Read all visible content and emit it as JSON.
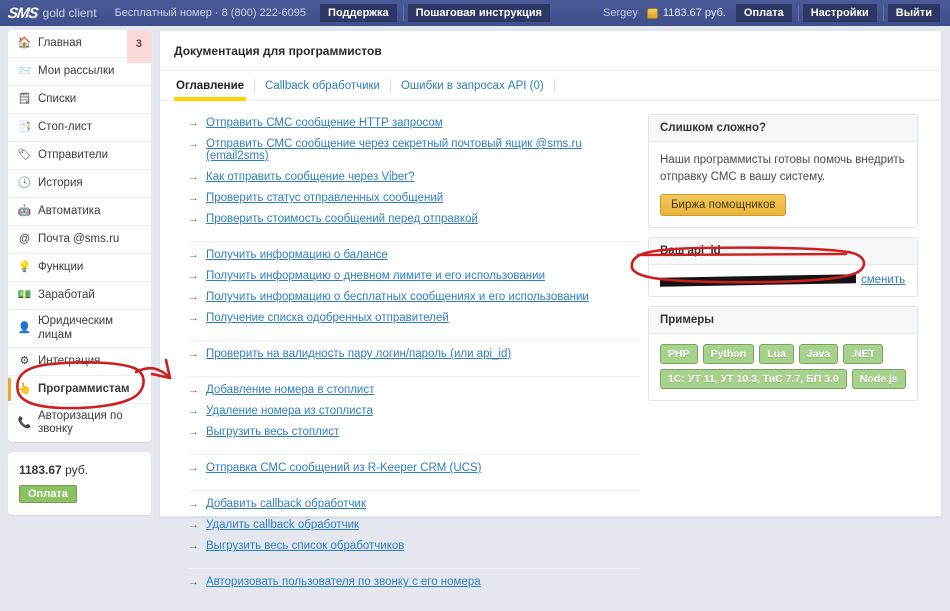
{
  "topbar": {
    "logo_main": "SMS",
    "logo_sub": "gold client",
    "free_number": "Бесплатный номер · 8 (800) 222-6095",
    "support_button": "Поддержка",
    "guide_button": "Пошаговая инструкция",
    "user_name": "Sergey",
    "coin_icon": "coin-icon",
    "balance": "1183.67 руб.",
    "pay_button": "Оплата",
    "settings_button": "Настройки",
    "logout_button": "Выйти"
  },
  "sidebar": {
    "items": [
      {
        "label": "Главная",
        "icon": "home-icon",
        "glyph": "🏠",
        "badge": "3",
        "active": false
      },
      {
        "label": "Мои рассылки",
        "icon": "mailing-icon",
        "glyph": "📨",
        "active": false
      },
      {
        "label": "Списки",
        "icon": "lists-icon",
        "glyph": "🗒",
        "active": false
      },
      {
        "label": "Стоп-лист",
        "icon": "stoplist-icon",
        "glyph": "📑",
        "active": false
      },
      {
        "label": "Отправители",
        "icon": "senders-tag-icon",
        "glyph": "🏷",
        "active": false
      },
      {
        "label": "История",
        "icon": "history-clock-icon",
        "glyph": "🕓",
        "active": false
      },
      {
        "label": "Автоматика",
        "icon": "robot-icon",
        "glyph": "🤖",
        "active": false
      },
      {
        "label": "Почта @sms.ru",
        "icon": "at-mail-icon",
        "glyph": "@",
        "active": false
      },
      {
        "label": "Функции",
        "icon": "lightbulb-icon",
        "glyph": "💡",
        "active": false
      },
      {
        "label": "Заработай",
        "icon": "money-icon",
        "glyph": "💵",
        "active": false
      },
      {
        "label": "Юридическим лицам",
        "icon": "person-suit-icon",
        "glyph": "👤",
        "active": false
      },
      {
        "label": "Интеграция",
        "icon": "integration-icon",
        "glyph": "⚙",
        "active": false
      },
      {
        "label": "Программистам",
        "icon": "hand-pointer-icon",
        "glyph": "👆",
        "active": true
      },
      {
        "label": "Авторизация по звонку",
        "icon": "phone-icon",
        "glyph": "📞",
        "active": false
      }
    ],
    "balance_amount": "1183.67",
    "balance_currency": "руб.",
    "pay_button": "Оплата"
  },
  "main": {
    "title": "Документация для программистов",
    "tabs": [
      {
        "label": "Оглавление",
        "active": true
      },
      {
        "label": "Callback обработчики",
        "active": false
      },
      {
        "label": "Ошибки в запросах API (0)",
        "active": false
      }
    ],
    "link_groups": [
      {
        "links": [
          "Отправить СМС сообщение HTTP запросом",
          "Отправить СМС сообщение через секретный почтовый ящик @sms.ru (email2sms)",
          "Как отправить сообщение через Viber?",
          "Проверить статус отправленных сообщений",
          "Проверить стоимость сообщений перед отправкой"
        ]
      },
      {
        "links": [
          "Получить информацию о балансе",
          "Получить информацию о дневном лимите и его использовании",
          "Получить информацию о бесплатных сообщениях и его использовании",
          "Получение списка одобренных отправителей"
        ]
      },
      {
        "links": [
          "Проверить на валидность пару логин/пароль (или api_id)"
        ]
      },
      {
        "links": [
          "Добавление номера в стоплист",
          "Удаление номера из стоплиста",
          "Выгрузить весь стоплист"
        ]
      },
      {
        "links": [
          "Отправка СМС сообщений из R-Keeper CRM (UCS)"
        ]
      },
      {
        "links": [
          "Добавить callback обработчик",
          "Удалить callback обработчик",
          "Выгрузить весь список обработчиков"
        ]
      },
      {
        "links": [
          "Авторизовать пользователя по звонку с его номера"
        ]
      }
    ]
  },
  "right_panels": {
    "help": {
      "title": "Слишком сложно?",
      "text": "Наши программисты готовы помочь внедрить отправку СМС в вашу систему.",
      "button": "Биржа помощников"
    },
    "api": {
      "title": "Ваш api_id",
      "value": "",
      "change_link": "сменить"
    },
    "examples": {
      "title": "Примеры",
      "badges": [
        "PHP",
        "Python",
        "Lua",
        "Java",
        ".NET",
        "1C: УТ 11, УТ 10.3, ТиС 7.7, БП 3.0",
        "Node.js"
      ]
    }
  },
  "colors": {
    "topbar": "#42518f",
    "accent_yellow": "#ffd400",
    "link_blue": "#2d7fc1",
    "badge_green": "#a9d18e",
    "annotation_red": "#d11f1f",
    "active_orange": "#f0a52a",
    "page_bg": "#e4e7ee"
  }
}
